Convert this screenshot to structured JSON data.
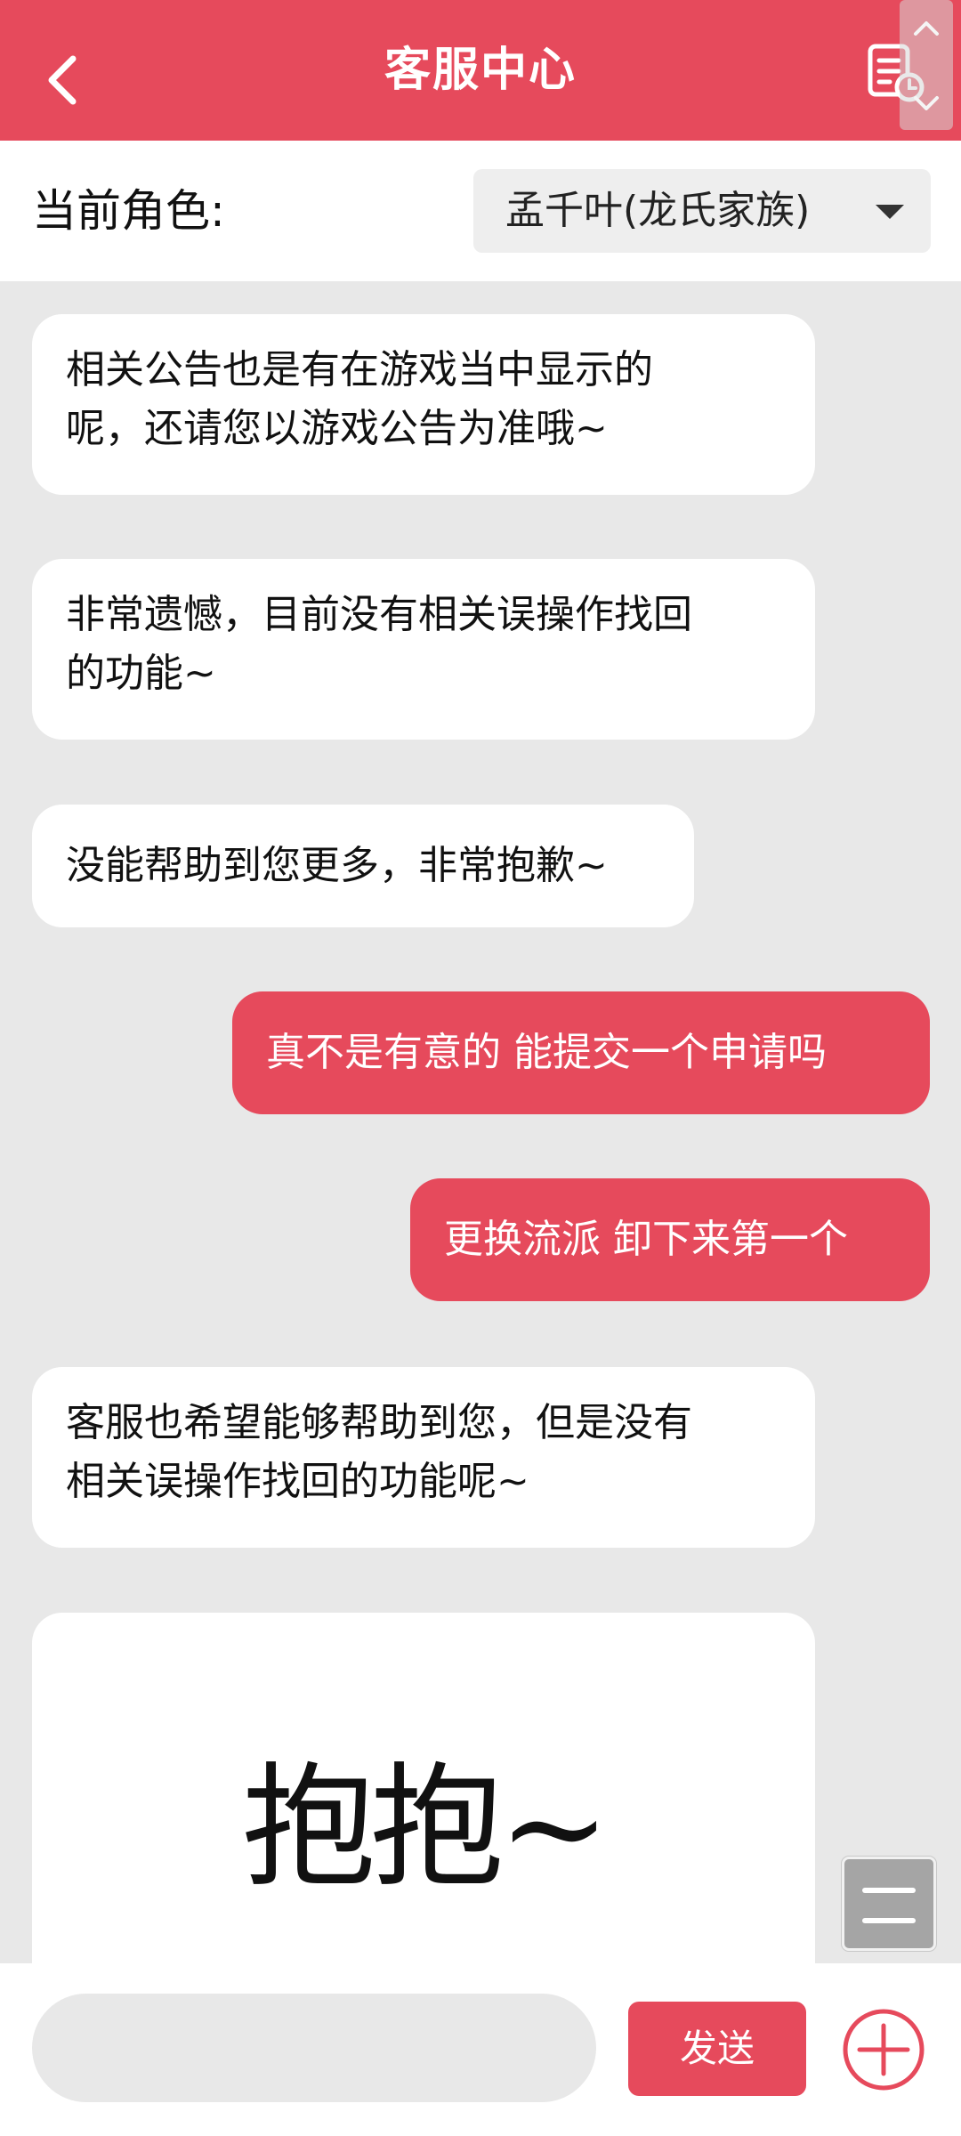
{
  "header": {
    "title": "客服中心",
    "back_icon": "chevron-left-icon",
    "history_icon": "history-document-icon"
  },
  "role": {
    "label": "当前角色:",
    "selected": "孟千叶(龙氏家族)"
  },
  "messages": [
    {
      "from": "agent",
      "lines": [
        "相关公告也是有在游戏当中显示的",
        "呢，还请您以游戏公告为准哦~"
      ]
    },
    {
      "from": "agent",
      "lines": [
        "非常遗憾，目前没有相关误操作找回",
        "的功能~"
      ]
    },
    {
      "from": "agent",
      "lines": [
        "没能帮助到您更多，非常抱歉~"
      ]
    },
    {
      "from": "user",
      "lines": [
        "真不是有意的 能提交一个申请吗"
      ]
    },
    {
      "from": "user",
      "lines": [
        "更换流派 卸下来第一个"
      ]
    },
    {
      "from": "agent",
      "lines": [
        "客服也希望能够帮助到您，但是没有",
        "相关误操作找回的功能呢~"
      ]
    }
  ],
  "sticker": {
    "text": "抱抱~"
  },
  "composer": {
    "input_value": "",
    "send_label": "发送",
    "plus_icon": "plus-circle-icon",
    "menu_icon": "menu-icon"
  },
  "colors": {
    "brand": "#e64a5c",
    "background": "#e8e8e8"
  }
}
